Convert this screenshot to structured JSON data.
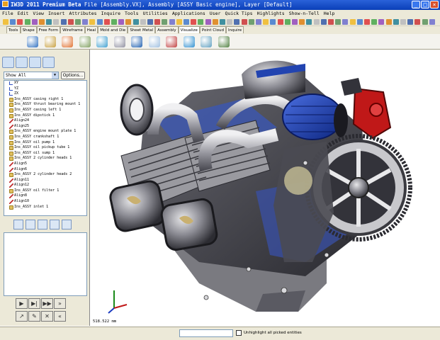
{
  "window": {
    "app_name": "IW3D 2011 Premium Beta",
    "title_rest": "   File [Assembly.VX],  Assembly [ASSY Basic engine],  Layer [Default]"
  },
  "menu": [
    "File",
    "Edit",
    "View",
    "Insert",
    "Attributes",
    "Inquire",
    "Tools",
    "Utilities",
    "Applications",
    "User",
    "Quick Tips",
    "Highlights",
    "Show-n-Tell",
    "Help"
  ],
  "tabs": [
    "Tools",
    "Shape",
    "Free Form",
    "Wireframe",
    "Heal",
    "Mold and Die",
    "Sheet Metal",
    "Assembly",
    "Visualize",
    "Point Cloud",
    "Inquire"
  ],
  "active_tab": "Visualize",
  "show_filter": {
    "value": "Show All"
  },
  "options_button": "Options...",
  "tree_items": [
    {
      "label": "XY",
      "icon": "axis"
    },
    {
      "label": "YZ",
      "icon": "axis"
    },
    {
      "label": "ZX",
      "icon": "axis"
    },
    {
      "label": "Ins_ASSY casing right 1",
      "icon": "part"
    },
    {
      "label": "Ins_ASSY thrust bearing mount 1",
      "icon": "part"
    },
    {
      "label": "Ins_ASSY casing left 1",
      "icon": "part"
    },
    {
      "label": "Ins_ASSY dipstick 1",
      "icon": "part"
    },
    {
      "label": "Align24",
      "icon": "align"
    },
    {
      "label": "Align25",
      "icon": "align"
    },
    {
      "label": "Ins_ASSY engine mount plate 1",
      "icon": "part"
    },
    {
      "label": "Ins_ASSY crankshaft 1",
      "icon": "part"
    },
    {
      "label": "Ins_ASSY oil pump 1",
      "icon": "part"
    },
    {
      "label": "Ins_ASSY oil pickup tube 1",
      "icon": "part"
    },
    {
      "label": "Ins_ASSY oil sump 1",
      "icon": "part"
    },
    {
      "label": "Ins_ASSY 2 cylinder heads 1",
      "icon": "part"
    },
    {
      "label": "Align5",
      "icon": "align"
    },
    {
      "label": "Align6",
      "icon": "align"
    },
    {
      "label": "Ins_ASSY 2 cylinder heads 2",
      "icon": "part"
    },
    {
      "label": "Align11",
      "icon": "align"
    },
    {
      "label": "Align12",
      "icon": "align"
    },
    {
      "label": "Ins_ASSY oil filter 1",
      "icon": "part"
    },
    {
      "label": "Align8",
      "icon": "align"
    },
    {
      "label": "Align10",
      "icon": "align"
    },
    {
      "label": "Ins_ASSY inlet 1",
      "icon": "part"
    }
  ],
  "viewport": {
    "scale_text": "518.522 mm"
  },
  "status": {
    "command_value": "",
    "checkbox_label": "Unhighlight all picked entities"
  },
  "colors": {
    "titlebar": "#0a3fb8",
    "chrome": "#ece9d8",
    "engine_dark": "#3a3a40",
    "engine_blue": "#1f3fa8",
    "engine_red": "#c01818"
  }
}
